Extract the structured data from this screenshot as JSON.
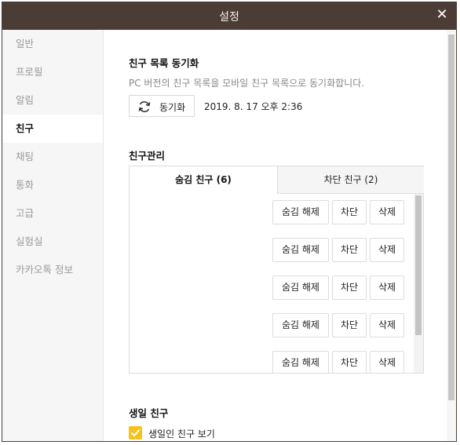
{
  "window": {
    "title": "설정",
    "close_icon": "close-icon"
  },
  "sidebar": {
    "items": [
      {
        "label": "일반"
      },
      {
        "label": "프로필"
      },
      {
        "label": "알림"
      },
      {
        "label": "친구",
        "active": true
      },
      {
        "label": "채팅"
      },
      {
        "label": "통화"
      },
      {
        "label": "고급"
      },
      {
        "label": "실험실"
      },
      {
        "label": "카카오톡 정보"
      }
    ]
  },
  "sync": {
    "title": "친구 목록 동기화",
    "description": "PC 버전의 친구 목록을 모바일 친구 목록으로 동기화합니다.",
    "button_label": "동기화",
    "button_icon": "refresh-icon",
    "last_sync": "2019. 8. 17 오후 2:36"
  },
  "friend_mgmt": {
    "title": "친구관리",
    "tabs": [
      {
        "label": "숨김 친구 (6)",
        "active": true
      },
      {
        "label": "차단 친구 (2)"
      }
    ],
    "row_buttons": {
      "unhide": "숨김 해제",
      "block": "차단",
      "delete": "삭제"
    },
    "row_count": 5
  },
  "birthday": {
    "title": "생일 친구",
    "checkbox_label": "생일인 친구 보기",
    "checked": true
  },
  "colors": {
    "titlebar": "#4b3c35",
    "checkbox": "#f6c21c"
  }
}
